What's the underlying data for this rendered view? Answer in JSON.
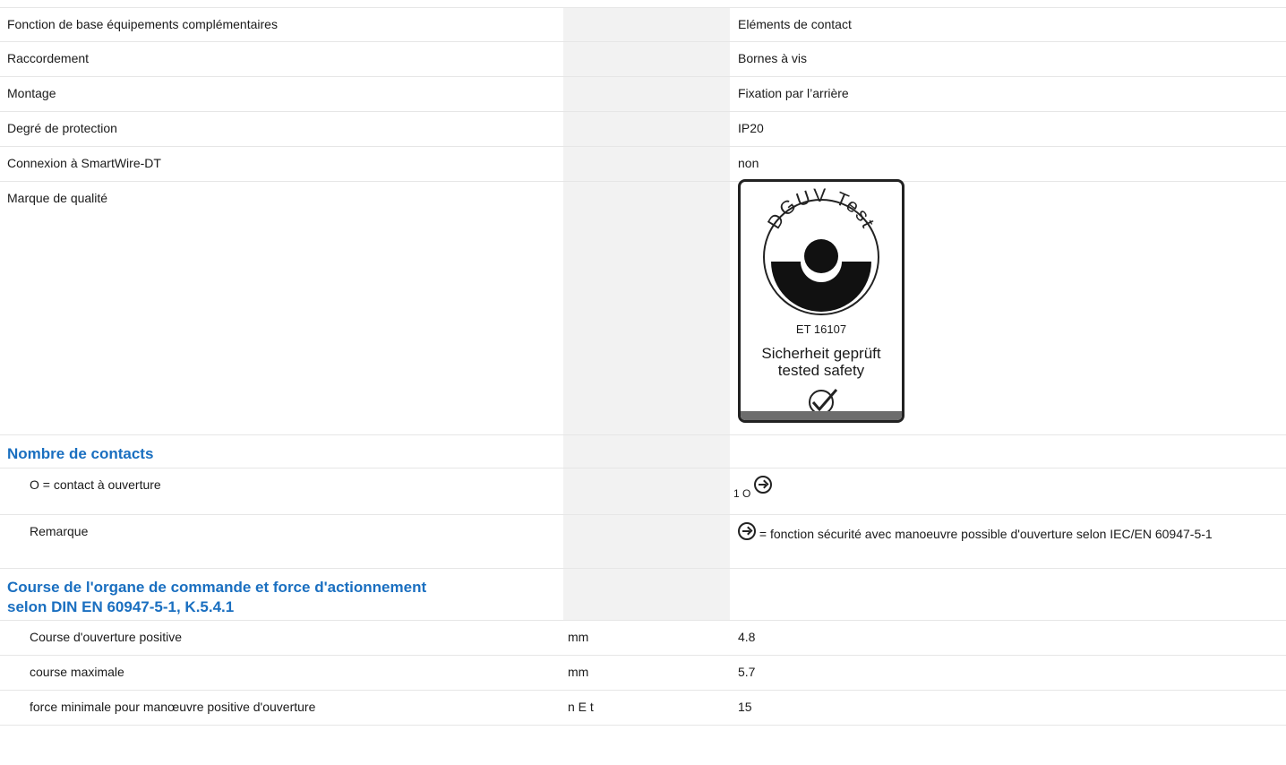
{
  "rows": [
    {
      "label": "Fonction de base équipements complémentaires",
      "unit": "",
      "value": "Eléments de contact"
    },
    {
      "label": "Raccordement",
      "unit": "",
      "value": "Bornes à vis"
    },
    {
      "label": "Montage",
      "unit": "",
      "value": "Fixation par l’arrière"
    },
    {
      "label": "Degré de protection",
      "unit": "",
      "value": "IP20"
    },
    {
      "label": "Connexion à SmartWire-DT",
      "unit": "",
      "value": "non"
    },
    {
      "label": "Marque de qualité",
      "unit": "",
      "value": ""
    }
  ],
  "quality_mark": {
    "ring_text": "DGUV Test",
    "number": "ET 16107",
    "line1": "Sicherheit geprüft",
    "line2": "tested safety"
  },
  "section1": {
    "heading": "Nombre de contacts",
    "contact_label": "O = contact à ouverture",
    "contact_value": "1 O",
    "remark_label": "Remarque",
    "remark_value": "= fonction sécurité avec manoeuvre possible d'ouverture selon IEC/EN 60947-5-1",
    "icon": "positive-opening-icon"
  },
  "section2": {
    "heading_line1": "Course de l'organe de commande et force d'actionnement",
    "heading_line2": "selon DIN EN 60947-5-1, K.5.4.1",
    "rows": [
      {
        "label": "Course d'ouverture positive",
        "unit": "mm",
        "value": "4.8"
      },
      {
        "label": "course maximale",
        "unit": "mm",
        "value": "5.7"
      },
      {
        "label": "force minimale pour manœuvre positive d'ouverture",
        "unit": "n E t",
        "value": "15"
      }
    ]
  }
}
